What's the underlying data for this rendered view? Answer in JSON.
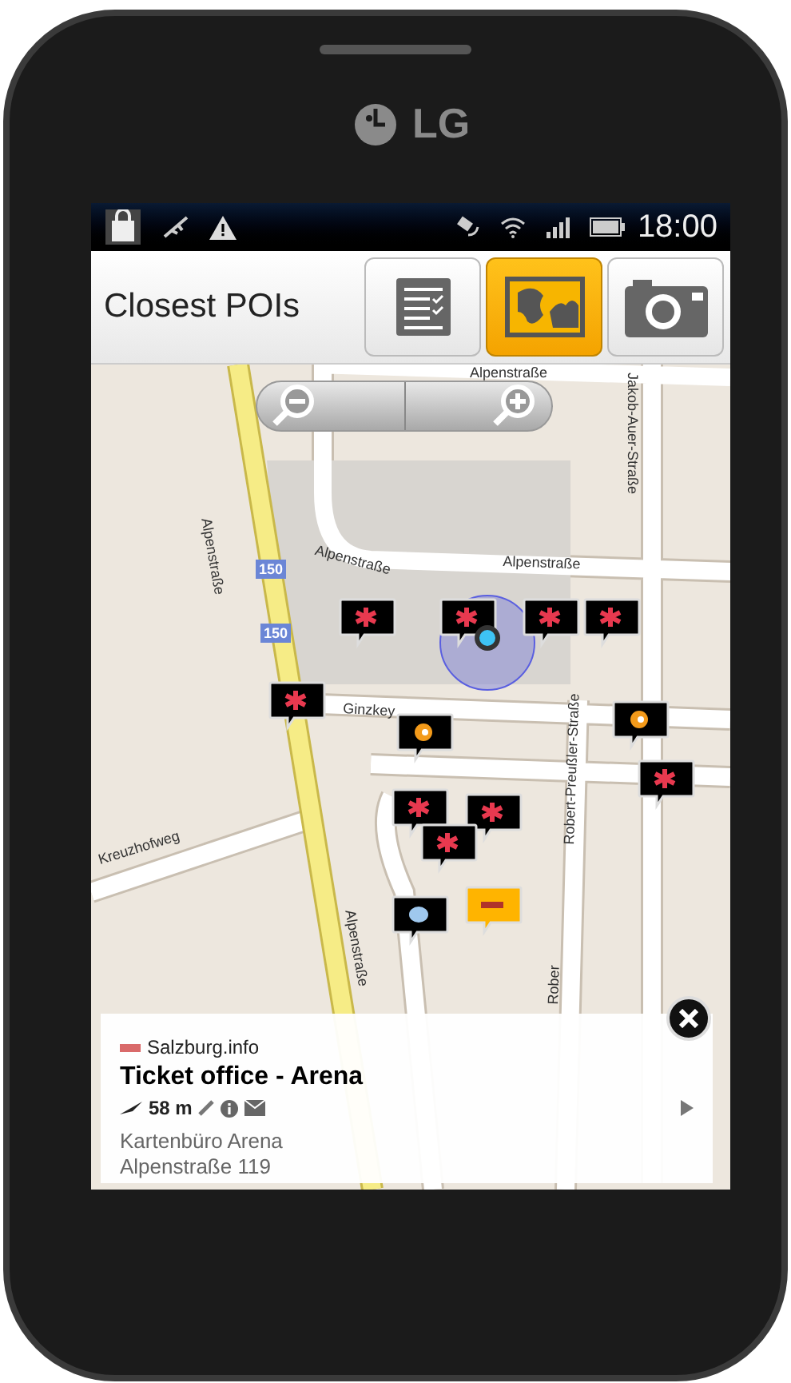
{
  "device": {
    "brand": "LG"
  },
  "status_bar": {
    "time": "18:00"
  },
  "header": {
    "title": "Closest POIs",
    "view_buttons": [
      {
        "kind": "list",
        "selected": false
      },
      {
        "kind": "map",
        "selected": true
      },
      {
        "kind": "camera",
        "selected": false
      }
    ]
  },
  "map": {
    "labels": [
      {
        "text": "Alpenstraße"
      },
      {
        "text": "Jakob-Auer-Straße"
      },
      {
        "text": "Alpenstraße"
      },
      {
        "text": "Alpenstraße"
      },
      {
        "text": "Alpenstraße"
      },
      {
        "text": "150"
      },
      {
        "text": "150"
      },
      {
        "text": "Ginzkey"
      },
      {
        "text": "Robert-Preußler-Straße"
      },
      {
        "text": "Alpenstraße"
      },
      {
        "text": "Kreuzhofweg"
      },
      {
        "text": "Rober"
      }
    ],
    "markers": [
      {
        "kind": "event"
      },
      {
        "kind": "event"
      },
      {
        "kind": "event"
      },
      {
        "kind": "event"
      },
      {
        "kind": "event"
      },
      {
        "kind": "food"
      },
      {
        "kind": "food"
      },
      {
        "kind": "event"
      },
      {
        "kind": "event"
      },
      {
        "kind": "event"
      },
      {
        "kind": "event"
      },
      {
        "kind": "info"
      },
      {
        "kind": "ticket"
      }
    ]
  },
  "poi_card": {
    "source": "Salzburg.info",
    "title": "Ticket office - Arena",
    "distance": "58 m",
    "subtitle": "Kartenbüro Arena",
    "address": "Alpenstraße 119"
  }
}
